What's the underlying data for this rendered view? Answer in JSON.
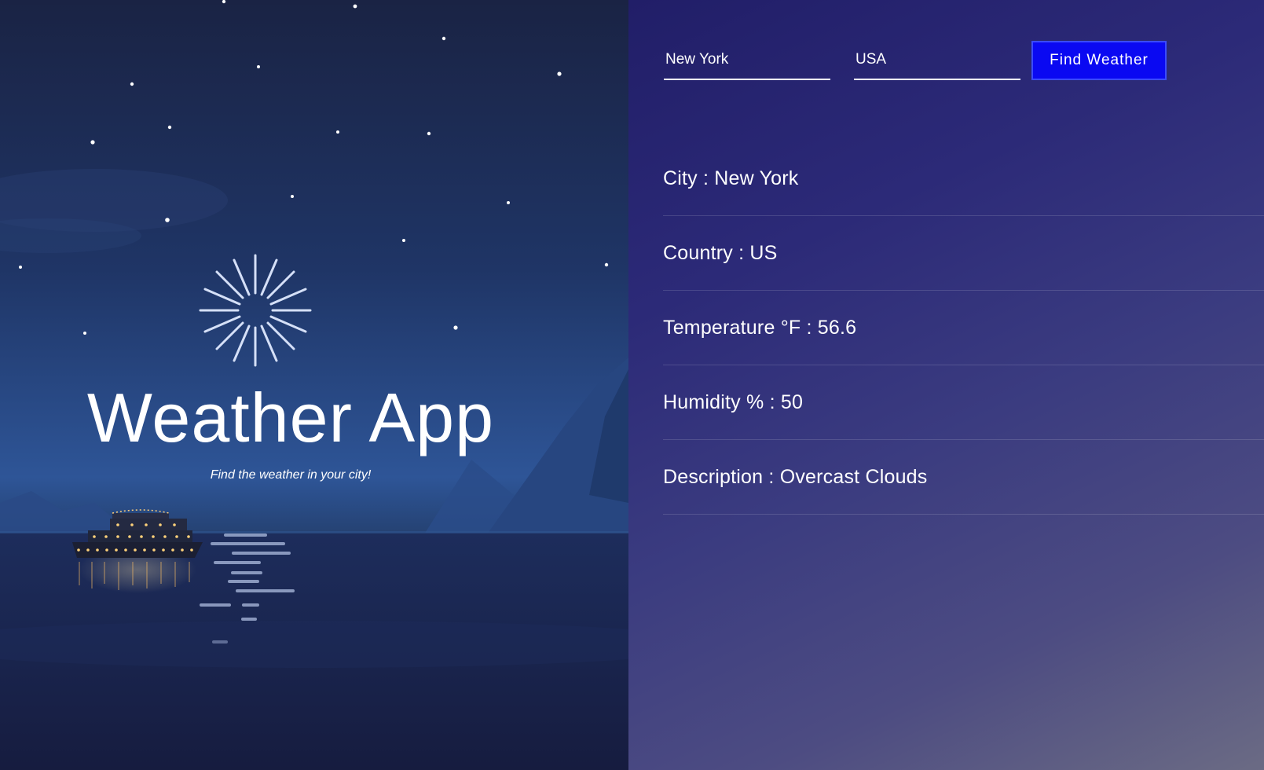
{
  "hero": {
    "title": "Weather App",
    "subtitle": "Find the weather in your city!"
  },
  "search": {
    "city_value": "New York",
    "country_value": "USA",
    "button_label": "Find Weather"
  },
  "results": [
    {
      "label": "City",
      "value": "New York"
    },
    {
      "label": "Country",
      "value": "US"
    },
    {
      "label": "Temperature °F",
      "value": "56.6"
    },
    {
      "label": "Humidity %",
      "value": "50"
    },
    {
      "label": "Description",
      "value": "Overcast Clouds"
    }
  ],
  "colors": {
    "button_bg": "#0a09f2",
    "right_panel_start": "#211e68",
    "right_panel_end": "#6b6b84",
    "left_panel_sky": "#1f3566"
  }
}
